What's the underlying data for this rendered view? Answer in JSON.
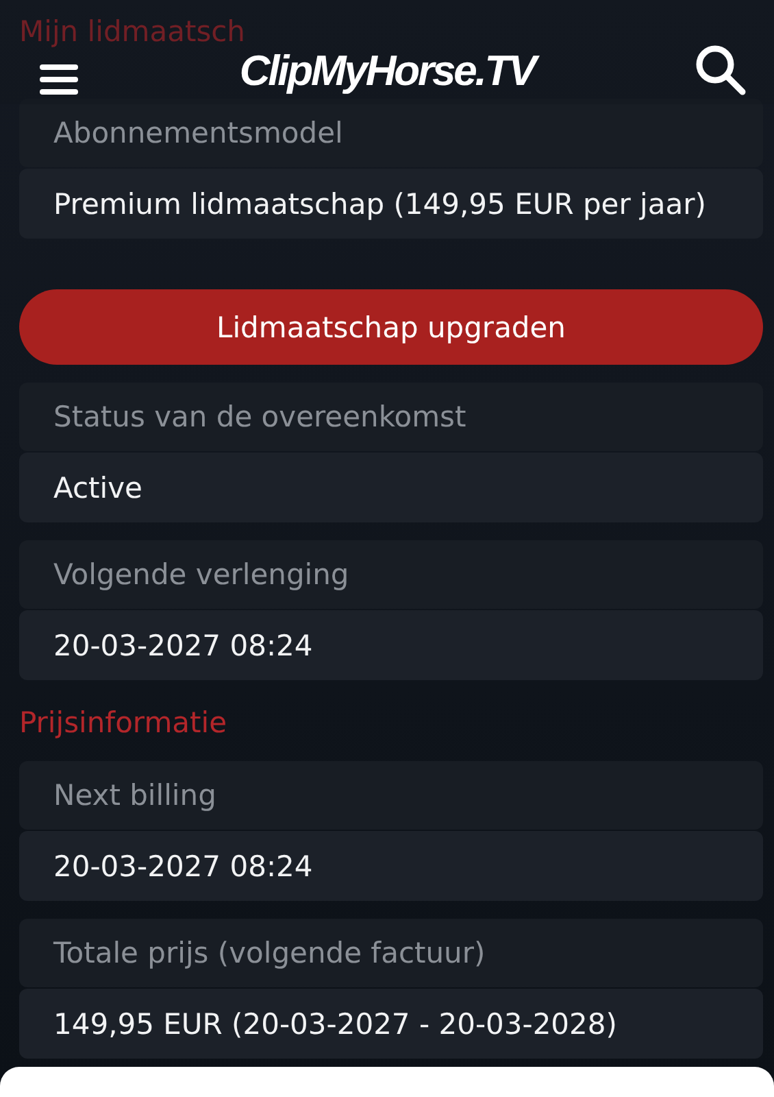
{
  "header": {
    "logo": "ClipMyHorse.TV"
  },
  "sections": [
    {
      "title": "Mijn lidmaatsch",
      "items": [
        {
          "kind": "field",
          "label": "Abonnementsmodel",
          "value": "Premium lidmaatschap (149,95 EUR per jaar)"
        },
        {
          "kind": "button",
          "label": "Lidmaatschap upgraden"
        },
        {
          "kind": "field",
          "label": "Status van de overeenkomst",
          "value": "Active"
        },
        {
          "kind": "field",
          "label": "Volgende verlenging",
          "value": "20-03-2027 08:24"
        }
      ]
    },
    {
      "title": "Prijsinformatie",
      "items": [
        {
          "kind": "field",
          "label": "Next billing",
          "value": "20-03-2027 08:24"
        },
        {
          "kind": "field",
          "label": "Totale prijs (volgende factuur)",
          "value": "149,95 EUR (20-03-2027 - 20-03-2028)"
        }
      ]
    }
  ]
}
